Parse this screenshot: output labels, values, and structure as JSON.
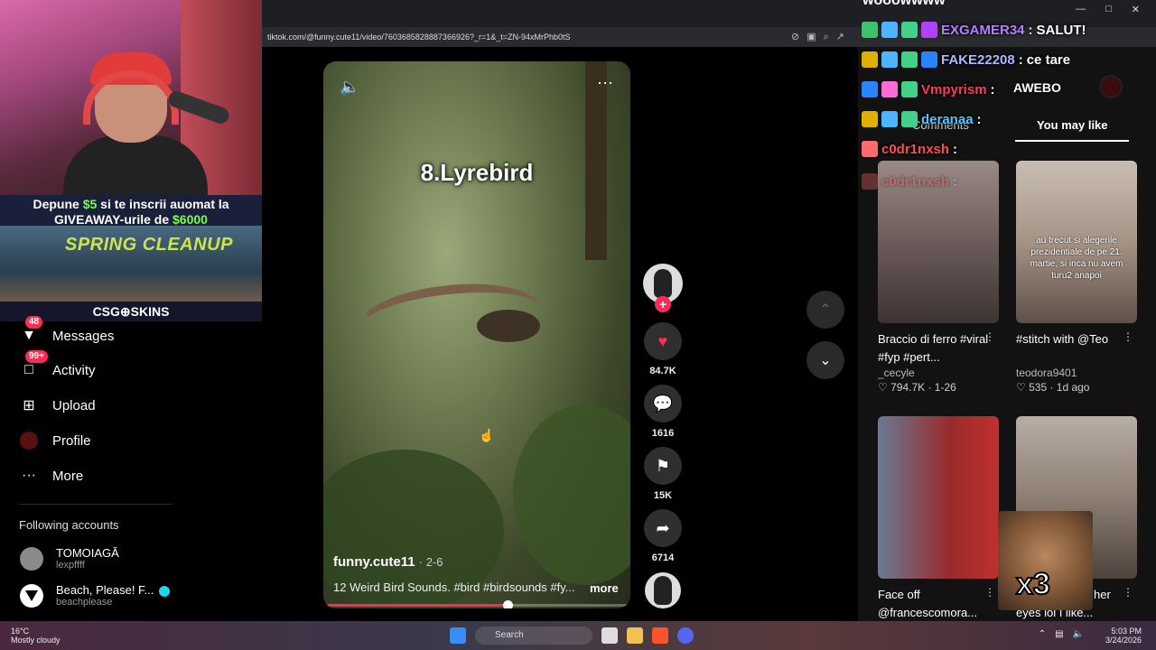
{
  "browser": {
    "url": "tiktok.com/@funny.cute11/video/7603685828887366926?_r=1&_t=ZN-94xMrPhb0tS"
  },
  "promo": {
    "line1_pre": "Depune ",
    "line1_amount": "$5",
    "line1_post": " si te inscrii auomat la",
    "line2_pre": "GIVEAWAY-urile de ",
    "line2_amount": "$6000",
    "spring": "SPRING CLEANUP",
    "brand": "CSG⊕SKINS"
  },
  "nav": {
    "messages": {
      "label": "Messages",
      "badge": "48"
    },
    "activity": {
      "label": "Activity",
      "badge": "99+"
    },
    "upload": {
      "label": "Upload"
    },
    "profile": {
      "label": "Profile"
    },
    "more": {
      "label": "More"
    }
  },
  "following": {
    "title": "Following accounts",
    "accounts": [
      {
        "name": "TOMOIAGĂ",
        "handle": "lexpffff"
      },
      {
        "name": "Beach, Please! F...",
        "handle": "beachplease"
      }
    ]
  },
  "video": {
    "overlay_title": "8.Lyrebird",
    "author": "funny.cute11",
    "date": "· 2-6",
    "caption": "12 Weird Bird Sounds. #bird #birdsounds #fy...",
    "more": "more",
    "progress": 0.6
  },
  "actions": {
    "likes": "84.7K",
    "comments": "1616",
    "saves": "15K",
    "shares": "6714"
  },
  "right": {
    "tab_comments": "Comments",
    "tab_you_may_like": "You may like",
    "cards": [
      {
        "title": "Braccio di ferro #viral #fyp #pert...",
        "user": "_cecyle",
        "meta": "♡ 794.7K · 1-26"
      },
      {
        "title": "#stitch with @Teo",
        "user": "teodora9401",
        "meta": "♡ 535 · 1d ago",
        "overlay": "au trecut si alegerile prezidentiale de pe 21. martie, si inca nu avem turu2 anapoi"
      },
      {
        "title": "Face off @francescomora...",
        "user": "",
        "meta": ""
      },
      {
        "title": "...ment behind her eyes lol I like...",
        "user": "",
        "meta": ""
      }
    ]
  },
  "chat": {
    "header": "wooowwww",
    "lines": [
      {
        "user": "EXGAMER34",
        "msg": "SALUT!",
        "color": "#b580ff"
      },
      {
        "user": "FAKE22208",
        "msg": "ce tare",
        "color": "#b0b6ff"
      },
      {
        "user": "Vmpyrism",
        "msg": "",
        "color": "#ff3b5c"
      },
      {
        "user": "deranaa",
        "msg": "",
        "color": "#4fc8ff"
      },
      {
        "user": "c0dr1nxsh",
        "msg": "",
        "color": "#ff4d4d"
      },
      {
        "user": "c0dr1nxsh",
        "msg": "",
        "color": "#ff4d4d"
      }
    ],
    "awebo": "AWEBO",
    "meme": "x3"
  },
  "taskbar": {
    "temp": "16°C",
    "weather": "Mostly cloudy",
    "search": "Search",
    "time": "5:03 PM",
    "date": "3/24/2026"
  }
}
